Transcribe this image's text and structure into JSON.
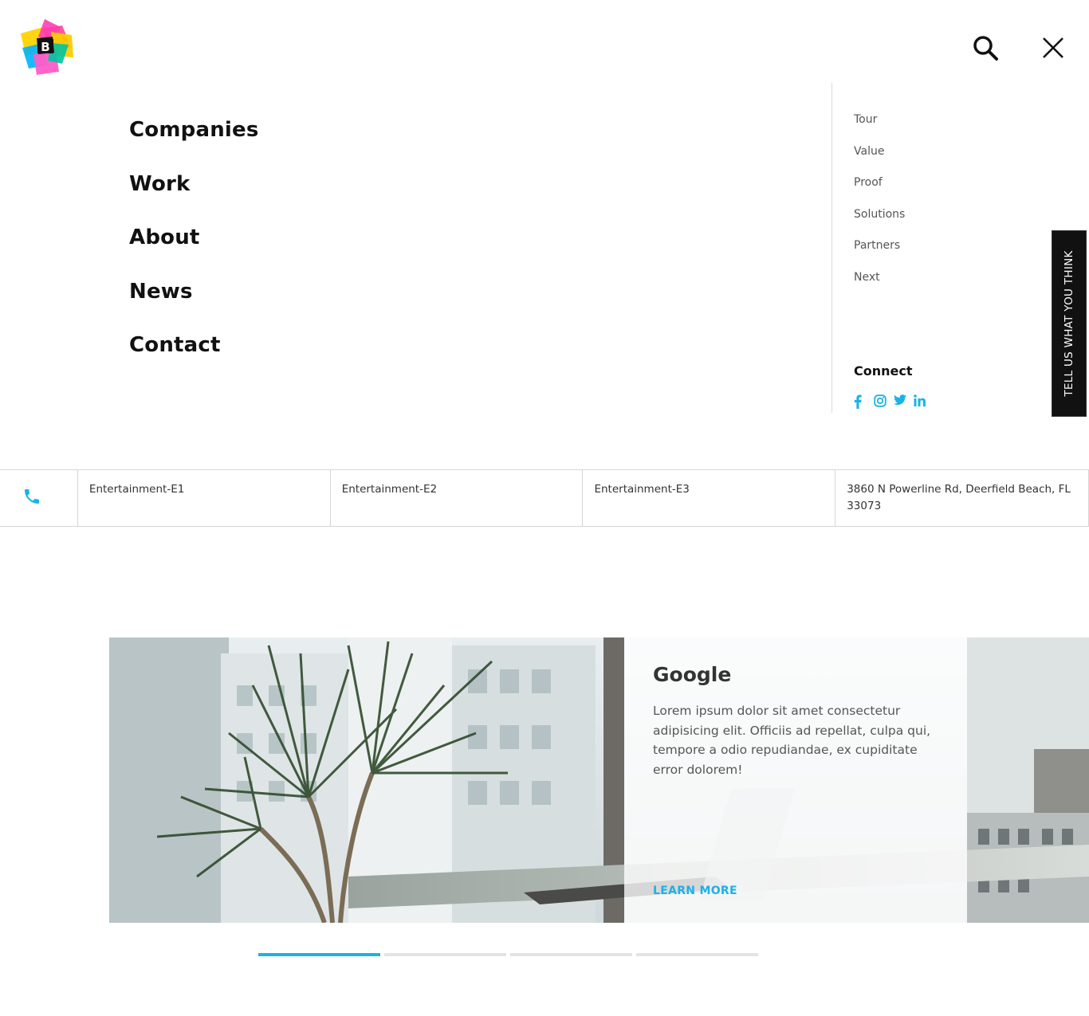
{
  "header": {
    "logo_letter": "B",
    "search_icon": "search-icon",
    "close_icon": "close-icon"
  },
  "main_nav": {
    "items": [
      {
        "label": "Companies"
      },
      {
        "label": "Work"
      },
      {
        "label": "About"
      },
      {
        "label": "News"
      },
      {
        "label": "Contact"
      }
    ]
  },
  "sub_nav": {
    "items": [
      {
        "label": "Tour"
      },
      {
        "label": "Value"
      },
      {
        "label": "Proof"
      },
      {
        "label": "Solutions"
      },
      {
        "label": "Partners"
      },
      {
        "label": "Next"
      }
    ]
  },
  "connect": {
    "title": "Connect",
    "icons": [
      "facebook-icon",
      "instagram-icon",
      "twitter-icon",
      "linkedin-icon"
    ],
    "icon_color": "#1ab2e8"
  },
  "feedback": {
    "label": "TELL US WHAT YOU THINK"
  },
  "info_bar": {
    "phone_icon": "phone-icon",
    "cells": [
      {
        "text": "Entertainment-E1"
      },
      {
        "text": "Entertainment-E2"
      },
      {
        "text": "Entertainment-E3"
      },
      {
        "text": "3860 N Powerline Rd, Deerfield Beach, FL 33073"
      }
    ]
  },
  "slide": {
    "title": "Google",
    "text": "Lorem ipsum dolor sit amet consectetur adipisicing elit. Officiis ad repellat, culpa qui, tempore a odio repudiandae, ex cupiditate error dolorem!",
    "cta": "LEARN MORE"
  },
  "pager": {
    "count": 4,
    "active_index": 0
  },
  "colors": {
    "accent": "#1ab2e8",
    "text": "#111111"
  }
}
